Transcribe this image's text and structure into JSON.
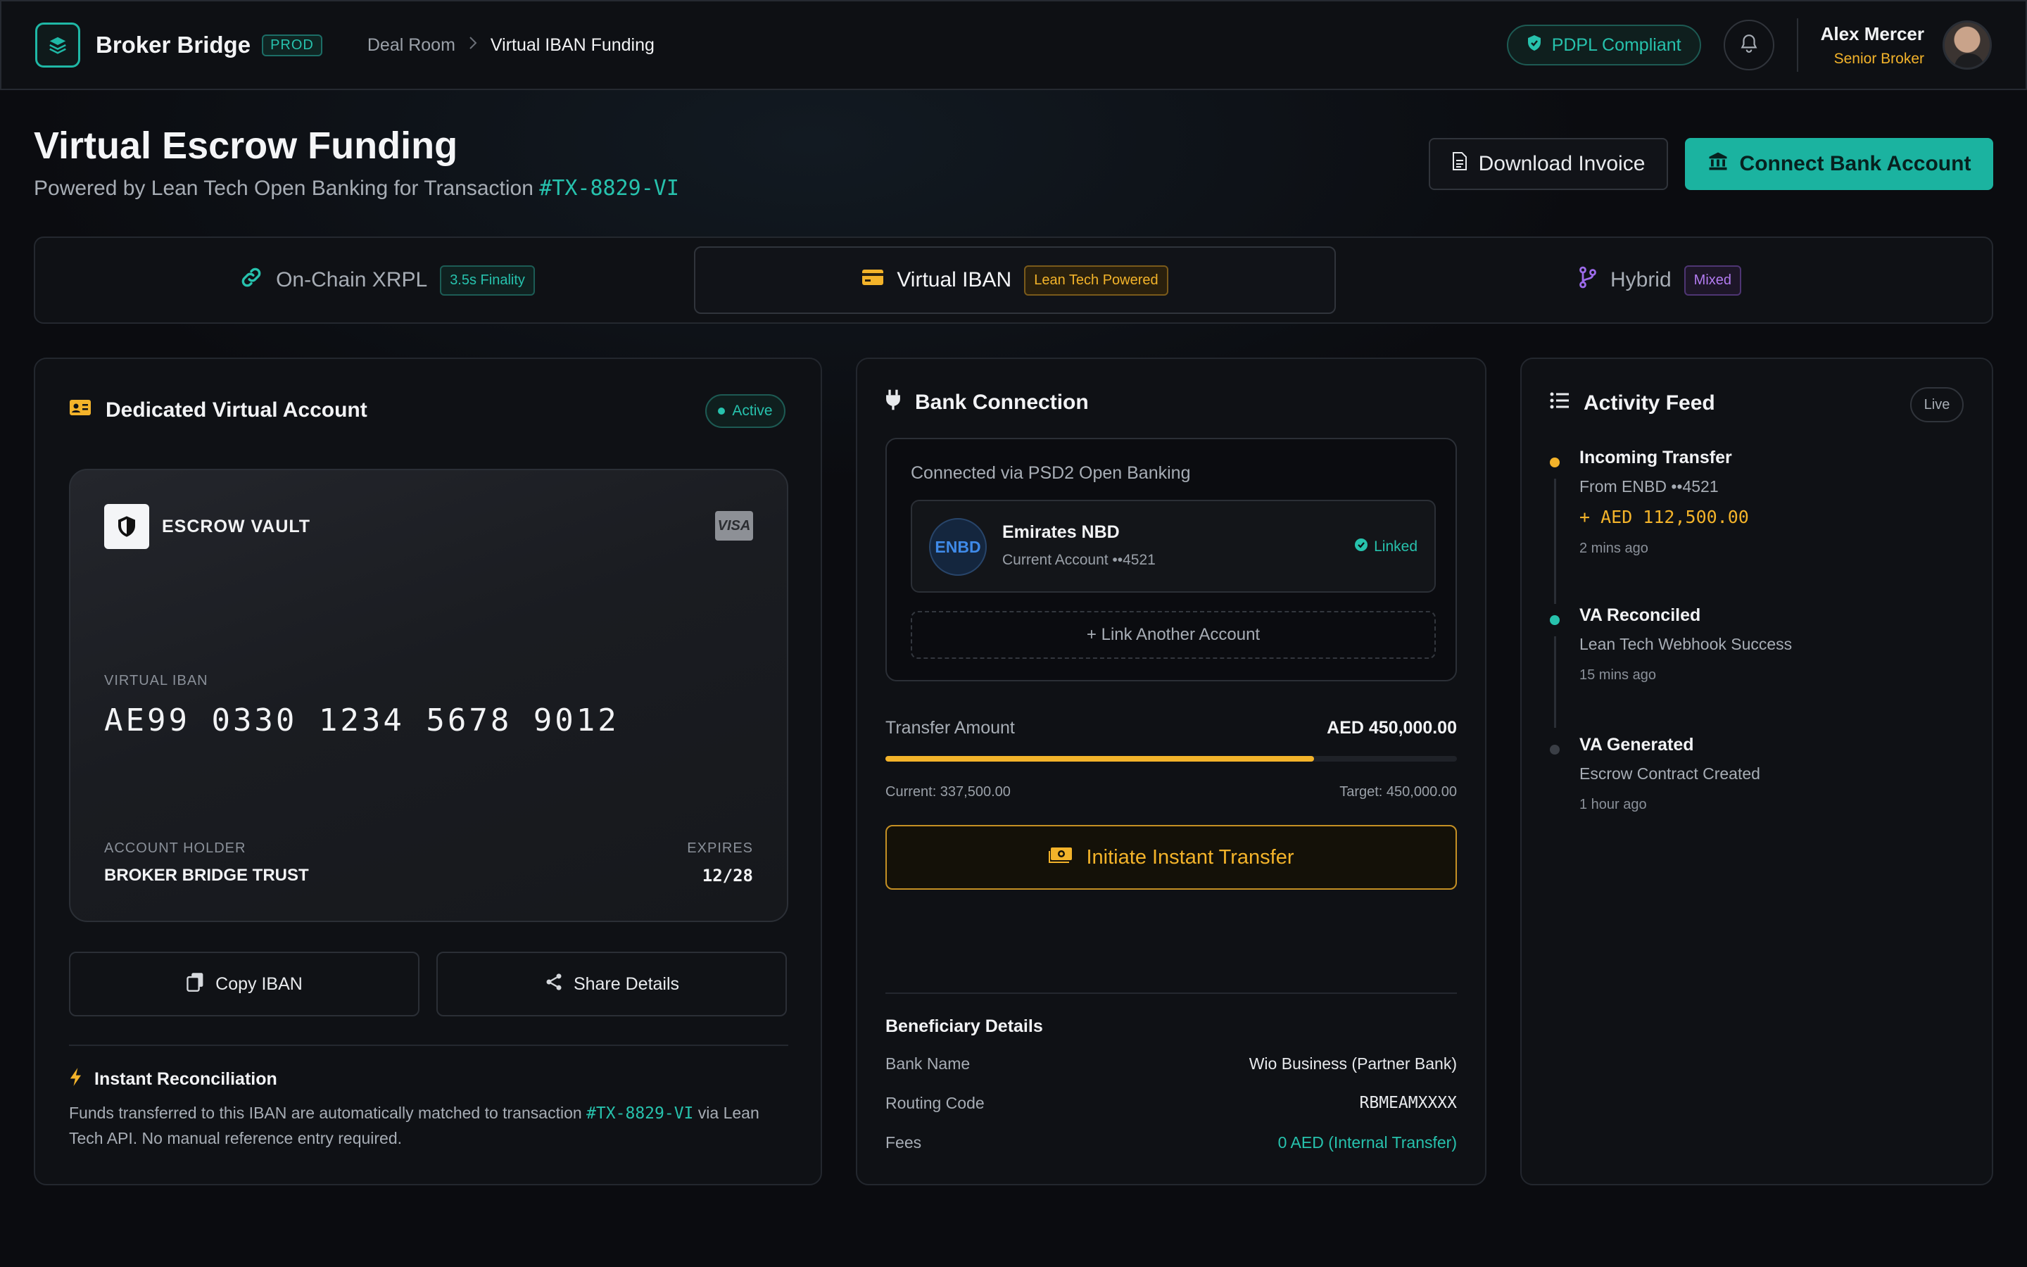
{
  "header": {
    "brand": "Broker Bridge",
    "env_badge": "PROD",
    "breadcrumb": [
      "Deal Room",
      "Virtual IBAN Funding"
    ],
    "compliance_badge": "PDPL Compliant",
    "user": {
      "name": "Alex Mercer",
      "role": "Senior Broker"
    }
  },
  "page": {
    "title": "Virtual Escrow Funding",
    "subtitle_prefix": "Powered by Lean Tech Open Banking for Transaction",
    "transaction_id": "#TX-8829-VI",
    "download_button": "Download Invoice",
    "connect_button": "Connect Bank Account"
  },
  "tabs": [
    {
      "label": "On-Chain XRPL",
      "tag": "3.5s Finality",
      "icon": "link-icon",
      "active": false
    },
    {
      "label": "Virtual IBAN",
      "tag": "Lean Tech Powered",
      "icon": "card-icon",
      "active": true
    },
    {
      "label": "Hybrid",
      "tag": "Mixed",
      "icon": "branch-icon",
      "active": false
    }
  ],
  "virtual_account": {
    "title": "Dedicated Virtual Account",
    "status": "Active",
    "card": {
      "vault_name": "ESCROW VAULT",
      "network": "VISA",
      "iban_label": "VIRTUAL IBAN",
      "iban": "AE99 0330 1234 5678 9012",
      "holder_label": "ACCOUNT HOLDER",
      "holder": "BROKER BRIDGE TRUST",
      "expires_label": "EXPIRES",
      "expires": "12/28"
    },
    "copy_button": "Copy IBAN",
    "share_button": "Share Details",
    "reconciliation": {
      "title": "Instant Reconciliation",
      "body_prefix": "Funds transferred to this IBAN are automatically matched to transaction",
      "tx": "#TX-8829-VI",
      "body_suffix": "via Lean Tech API. No manual reference entry required."
    }
  },
  "bank_connection": {
    "title": "Bank Connection",
    "via": "Connected via PSD2 Open Banking",
    "bank": {
      "logo": "ENBD",
      "name": "Emirates NBD",
      "account": "Current Account ••4521",
      "status": "Linked"
    },
    "link_another": "+ Link Another Account",
    "transfer": {
      "label": "Transfer Amount",
      "amount": "AED 450,000.00",
      "progress": 0.75,
      "current": "Current: 337,500.00",
      "target": "Target: 450,000.00"
    },
    "initiate_button": "Initiate Instant Transfer",
    "beneficiary": {
      "title": "Beneficiary Details",
      "rows": [
        {
          "key": "Bank Name",
          "value": "Wio Business (Partner Bank)"
        },
        {
          "key": "Routing Code",
          "value": "RBMEAMXXXX"
        },
        {
          "key": "Fees",
          "value": "0 AED (Internal Transfer)"
        }
      ]
    }
  },
  "activity": {
    "title": "Activity Feed",
    "live": "Live",
    "items": [
      {
        "title": "Incoming Transfer",
        "sub": "From ENBD ••4521",
        "amount": "+ AED 112,500.00",
        "time": "2 mins ago",
        "color": "#f3b32a"
      },
      {
        "title": "VA Reconciled",
        "sub": "Lean Tech Webhook Success",
        "time": "15 mins ago",
        "color": "#27c2ad"
      },
      {
        "title": "VA Generated",
        "sub": "Escrow Contract Created",
        "time": "1 hour ago",
        "color": "#3a3e45"
      }
    ]
  },
  "colors": {
    "accent": "#1bb3a0",
    "amber": "#f3b32a",
    "background": "#0b0c10"
  }
}
